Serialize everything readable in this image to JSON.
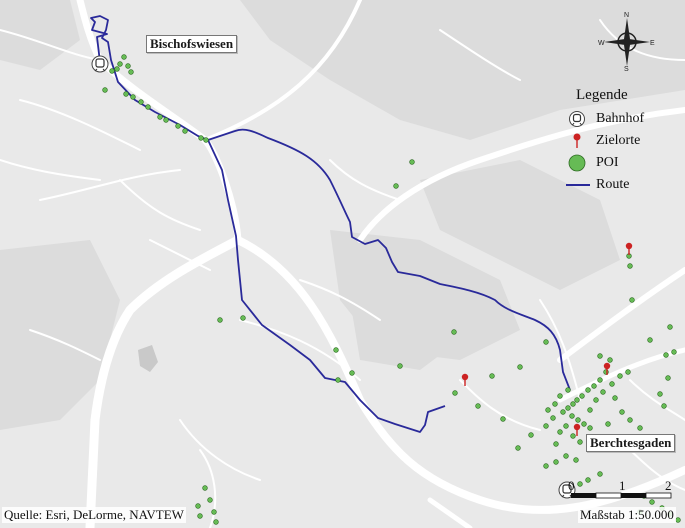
{
  "town_labels": {
    "bischofswiesen": "Bischofswiesen",
    "berchtesgaden": "Berchtesgaden"
  },
  "legend": {
    "title": "Legende",
    "items": [
      {
        "label": "Bahnhof",
        "icon": "train-station-icon"
      },
      {
        "label": "Zielorte",
        "icon": "destination-pin-icon",
        "color": "#cc2222"
      },
      {
        "label": "POI",
        "icon": "poi-dot-icon",
        "color": "#66bb55"
      },
      {
        "label": "Route",
        "icon": "route-line-icon",
        "color": "#2a2a9a"
      }
    ]
  },
  "compass": {
    "n": "N",
    "s": "S",
    "w": "W",
    "e": "E"
  },
  "scale_bar": {
    "ticks": [
      "0",
      "1",
      "2"
    ],
    "label": "Maßstab 1:50.000"
  },
  "source_credit": "Quelle: Esri, DeLorme, NAVTEW",
  "colors": {
    "background_land": "#e8e8e8",
    "terrain_shade": "#dcdcdc",
    "road": "#ffffff",
    "route": "#2a2a9a",
    "poi": "#66bb55",
    "destination": "#cc2222"
  }
}
